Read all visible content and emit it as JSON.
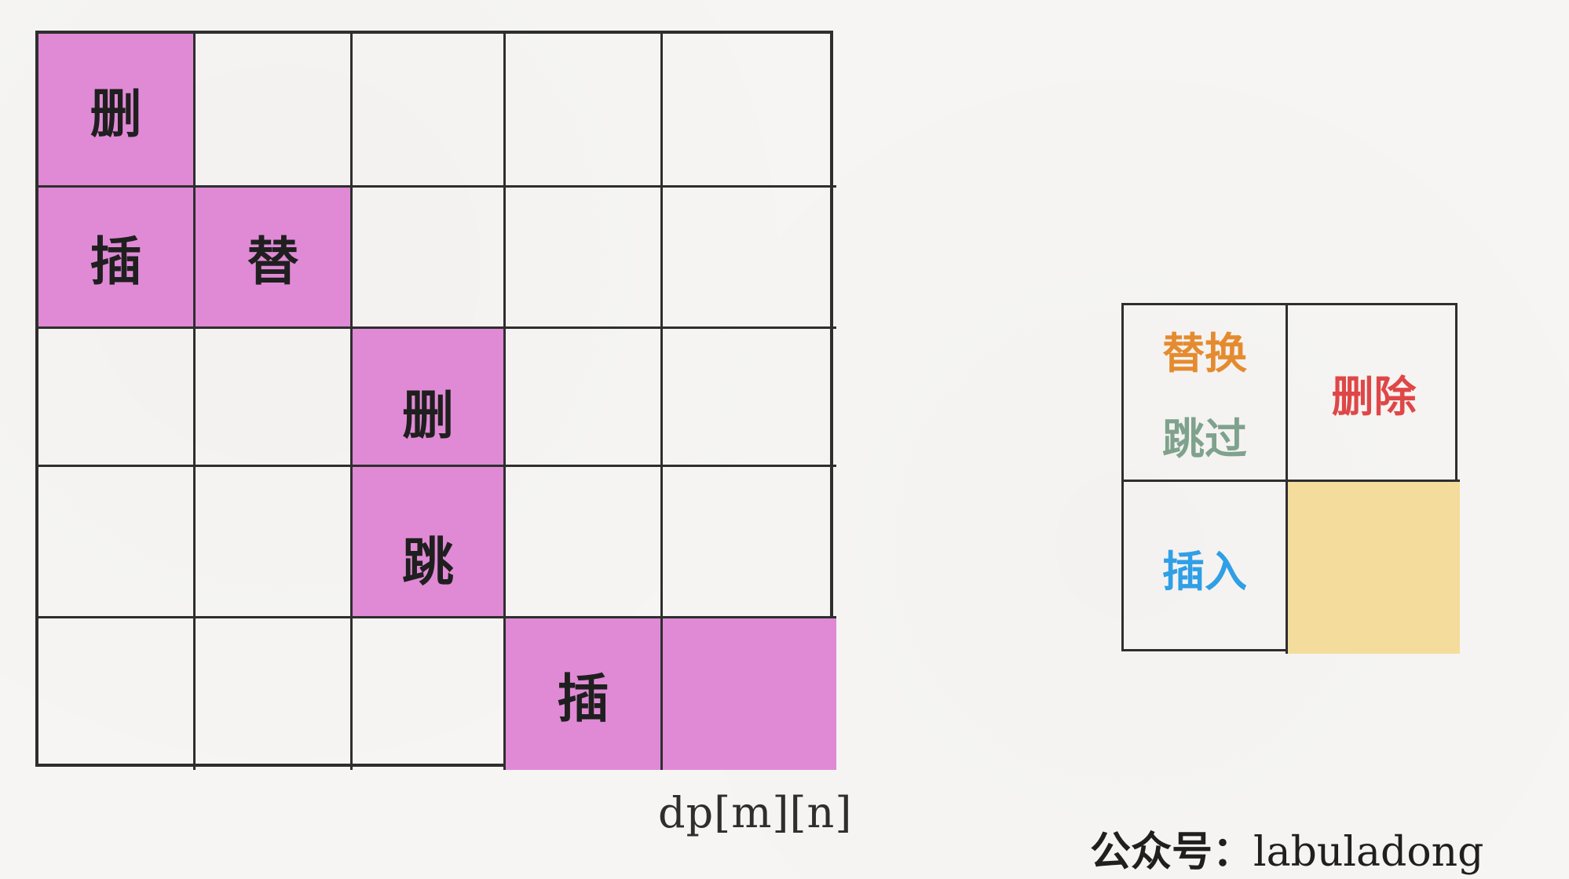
{
  "grid": {
    "rows": [
      [
        {
          "text": "删",
          "highlight": true
        },
        {
          "text": "",
          "highlight": false
        },
        {
          "text": "",
          "highlight": false
        },
        {
          "text": "",
          "highlight": false
        },
        {
          "text": "",
          "highlight": false
        }
      ],
      [
        {
          "text": "插",
          "highlight": true
        },
        {
          "text": "替",
          "highlight": true
        },
        {
          "text": "",
          "highlight": false
        },
        {
          "text": "",
          "highlight": false
        },
        {
          "text": "",
          "highlight": false
        }
      ],
      [
        {
          "text": "",
          "highlight": false
        },
        {
          "text": "",
          "highlight": false
        },
        {
          "text": "删",
          "highlight": true
        },
        {
          "text": "",
          "highlight": false
        },
        {
          "text": "",
          "highlight": false
        }
      ],
      [
        {
          "text": "",
          "highlight": false
        },
        {
          "text": "",
          "highlight": false
        },
        {
          "text": "跳",
          "highlight": true
        },
        {
          "text": "",
          "highlight": false
        },
        {
          "text": "",
          "highlight": false
        }
      ],
      [
        {
          "text": "",
          "highlight": false
        },
        {
          "text": "",
          "highlight": false
        },
        {
          "text": "",
          "highlight": false
        },
        {
          "text": "插",
          "highlight": true
        },
        {
          "text": "",
          "highlight": true
        }
      ]
    ],
    "label": "dp[m][n]",
    "highlight_color": "#e08ad6"
  },
  "legend": {
    "replace": "替换",
    "skip": "跳过",
    "delete": "删除",
    "insert": "插入",
    "colors": {
      "replace": "#e58b2f",
      "skip": "#7fa28d",
      "delete": "#df4747",
      "insert": "#2f9fe6",
      "target": "#f4dd9c"
    }
  },
  "footer": {
    "prefix": "公众号：",
    "account": "labuladong"
  }
}
